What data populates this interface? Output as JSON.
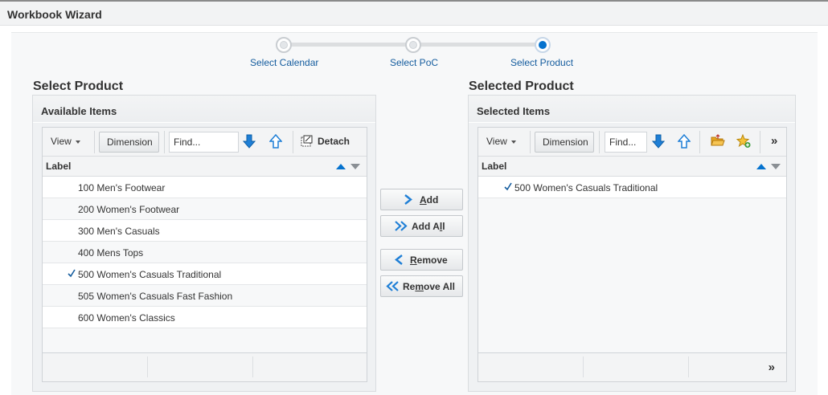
{
  "window": {
    "title": "Workbook Wizard"
  },
  "train": {
    "steps": [
      {
        "label": "Select Calendar",
        "state": "visited"
      },
      {
        "label": "Select PoC",
        "state": "visited"
      },
      {
        "label": "Select Product",
        "state": "current"
      }
    ],
    "current_color": "#0572ce"
  },
  "left": {
    "section_title": "Select Product",
    "panel_title": "Available Items",
    "toolbar": {
      "view_label": "View",
      "dimension_label": "Dimension",
      "find_placeholder": "Find...",
      "detach_label": "Detach"
    },
    "column_label": "Label",
    "items": [
      {
        "label": "100 Men's Footwear",
        "checked": false
      },
      {
        "label": "200 Women's Footwear",
        "checked": false
      },
      {
        "label": "300 Men's Casuals",
        "checked": false
      },
      {
        "label": "400 Mens Tops",
        "checked": false
      },
      {
        "label": "500 Women's Casuals Traditional",
        "checked": true
      },
      {
        "label": "505 Women's Casuals Fast Fashion",
        "checked": false
      },
      {
        "label": "600 Women's Classics",
        "checked": false
      }
    ]
  },
  "shuttle": {
    "add": {
      "pre": "",
      "mnemonic": "A",
      "post": "dd"
    },
    "add_all": {
      "pre": "Add A",
      "mnemonic": "l",
      "post": "l"
    },
    "remove": {
      "pre": "",
      "mnemonic": "R",
      "post": "emove"
    },
    "remove_all": {
      "pre": "Re",
      "mnemonic": "m",
      "post": "ove All"
    }
  },
  "right": {
    "section_title": "Selected Product",
    "panel_title": "Selected Items",
    "toolbar": {
      "view_label": "View",
      "dimension_label": "Dimension",
      "find_placeholder": "Find...",
      "more_label": "»"
    },
    "column_label": "Label",
    "items": [
      {
        "label": "500 Women's Casuals Traditional",
        "checked": true
      }
    ],
    "footer_more_label": "»"
  },
  "icons": {
    "move_down": "arrow-down-icon",
    "move_up": "arrow-up-icon",
    "detach": "detach-icon",
    "folder": "folder-open-icon",
    "favorite_add": "star-add-icon",
    "sort_asc": "sort-ascending-icon",
    "sort_desc": "sort-descending-icon",
    "check": "checkmark-icon"
  }
}
